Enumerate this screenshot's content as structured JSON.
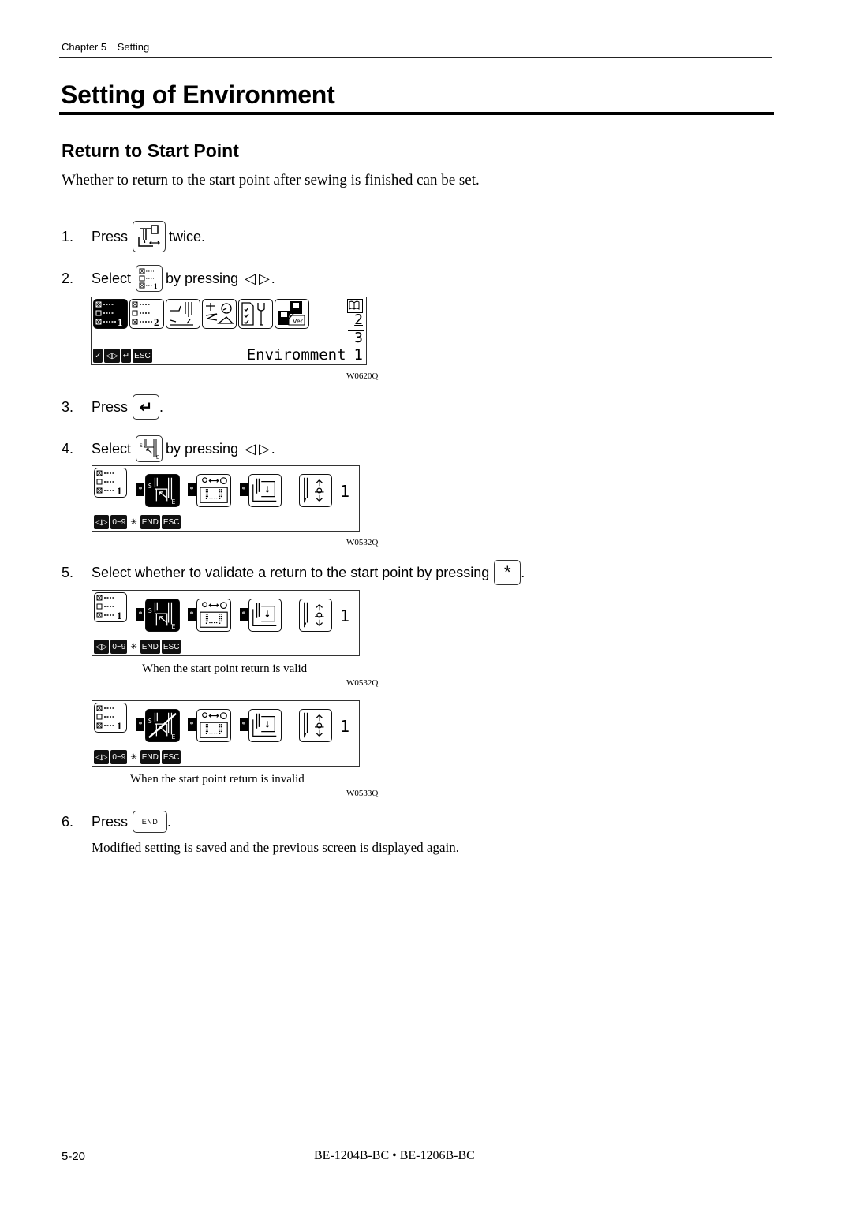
{
  "header": {
    "chapter": "Chapter 5",
    "section": "Setting"
  },
  "title": "Setting of Environment",
  "subtitle": "Return to Start Point",
  "intro": "Whether to return to the start point after sewing is finished can be set.",
  "steps": [
    {
      "num": "1.",
      "text": "Press",
      "key_icon": "sewing-head-mode-icon",
      "after": "twice."
    },
    {
      "num": "2.",
      "text": "Select",
      "key_icon": "environment-1-icon",
      "after": "by pressing"
    },
    {
      "num": "3.",
      "text": "Press",
      "key_icon": "enter-icon",
      "key_label": "↵",
      "after": "."
    },
    {
      "num": "4.",
      "text": "Select",
      "key_icon": "start-point-return-icon",
      "after": "by pressing"
    },
    {
      "num": "5.",
      "text": "Select whether to validate a return to the start point by pressing",
      "key_label": "*",
      "after": "."
    },
    {
      "num": "6.",
      "text": "Press",
      "key_label": "END",
      "after": "."
    }
  ],
  "arrows": {
    "left": "◁",
    "right": "▷",
    "end": "."
  },
  "screen1": {
    "code": "W0620Q",
    "label": "Enviromment",
    "page_current": "1",
    "page_items": [
      "2",
      "3"
    ],
    "tabs": [
      "environment-1",
      "environment-2",
      "sewing-machine",
      "speed-settings",
      "checklist-maintenance",
      "version-data"
    ],
    "tab_labels": [
      "1",
      "2"
    ],
    "bar": [
      "✓",
      "◁▷",
      "↵",
      "ESC"
    ]
  },
  "screen2": {
    "code": "W0532Q",
    "value": "1",
    "env_label": "1",
    "bar": [
      "◁▷",
      "0~9",
      "✳",
      "END",
      "ESC"
    ],
    "star": "*"
  },
  "screen3": {
    "code": "W0532Q",
    "caption": "When the start point return is valid",
    "value": "1",
    "env_label": "1",
    "bar": [
      "◁▷",
      "0~9",
      "✳",
      "END",
      "ESC"
    ],
    "star": "*"
  },
  "screen4": {
    "code": "W0533Q",
    "caption": "When the start point return is invalid",
    "value": "1",
    "env_label": "1",
    "bar": [
      "◁▷",
      "0~9",
      "✳",
      "END",
      "ESC"
    ],
    "star": "*"
  },
  "step6_note": "Modified setting is saved and the previous screen is displayed again.",
  "footer": {
    "page": "5-20",
    "models": "BE-1204B-BC • BE-1206B-BC"
  }
}
